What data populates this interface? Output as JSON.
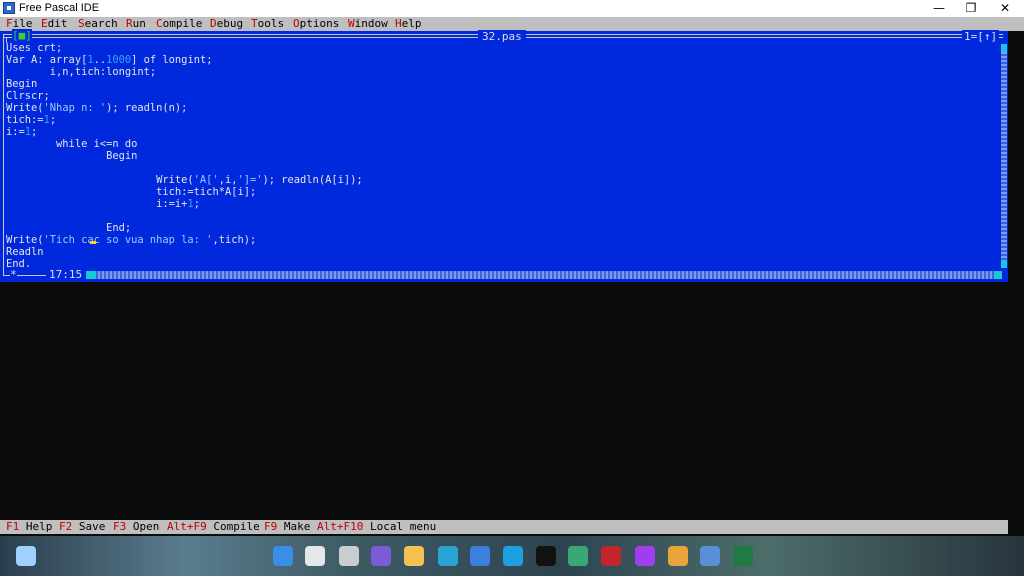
{
  "window": {
    "title": "Free Pascal IDE",
    "minimize_glyph": "—",
    "restore_glyph": "❐",
    "close_glyph": "✕"
  },
  "menu": [
    {
      "hotkey": "F",
      "rest": "ile"
    },
    {
      "hotkey": "E",
      "rest": "dit"
    },
    {
      "hotkey": "S",
      "rest": "earch"
    },
    {
      "hotkey": "R",
      "rest": "un"
    },
    {
      "hotkey": "C",
      "rest": "ompile"
    },
    {
      "hotkey": "D",
      "rest": "ebug"
    },
    {
      "hotkey": "T",
      "rest": "ools"
    },
    {
      "hotkey": "O",
      "rest": "ptions"
    },
    {
      "hotkey": "W",
      "rest": "indow"
    },
    {
      "hotkey": "H",
      "rest": "elp"
    }
  ],
  "editor": {
    "filename": "32.pas",
    "window_number": "1=[↑]",
    "close_box": "[■]",
    "modified_mark": "*",
    "cursor_position": "17:15",
    "lines": [
      [
        {
          "t": "Uses crt;"
        }
      ],
      [
        {
          "t": "Var A: array["
        },
        {
          "t": "1",
          "c": "num"
        },
        {
          "t": ".."
        },
        {
          "t": "1000",
          "c": "num"
        },
        {
          "t": "] of longint;"
        }
      ],
      [
        {
          "t": "       i,n,tich:longint;"
        }
      ],
      [
        {
          "t": "Begin"
        }
      ],
      [
        {
          "t": "Clrscr;"
        }
      ],
      [
        {
          "t": "Write("
        },
        {
          "t": "'Nhap n: '",
          "c": "str"
        },
        {
          "t": "); readln(n);"
        }
      ],
      [
        {
          "t": "tich:="
        },
        {
          "t": "1",
          "c": "num"
        },
        {
          "t": ";"
        }
      ],
      [
        {
          "t": "i:="
        },
        {
          "t": "1",
          "c": "num"
        },
        {
          "t": ";"
        }
      ],
      [
        {
          "t": "        while i<=n do"
        }
      ],
      [
        {
          "t": "                Begin"
        }
      ],
      [
        {
          "t": ""
        }
      ],
      [
        {
          "t": "                        Write("
        },
        {
          "t": "'A['",
          "c": "str"
        },
        {
          "t": ",i,"
        },
        {
          "t": "']='",
          "c": "str"
        },
        {
          "t": "); readln(A[i]);"
        }
      ],
      [
        {
          "t": "                        tich:=tich*A[i];"
        }
      ],
      [
        {
          "t": "                        i:=i+"
        },
        {
          "t": "1",
          "c": "num"
        },
        {
          "t": ";"
        }
      ],
      [
        {
          "t": ""
        }
      ],
      [
        {
          "t": "                End;"
        }
      ],
      [
        {
          "t": "Write("
        },
        {
          "t": "'Tich cac so vua nhap la: '",
          "c": "str"
        },
        {
          "t": ",tich);"
        }
      ],
      [
        {
          "t": "Readln"
        }
      ],
      [
        {
          "t": "End."
        }
      ]
    ]
  },
  "statusbar": [
    {
      "key": "F1",
      "label": " Help"
    },
    {
      "key": "F2",
      "label": " Save"
    },
    {
      "key": "F3",
      "label": " Open"
    },
    {
      "key": "Alt+F9",
      "label": " Compile"
    },
    {
      "key": "F9",
      "label": " Make"
    },
    {
      "key": "Alt+F10",
      "label": " Local menu"
    }
  ],
  "taskbar": {
    "icons": [
      {
        "name": "weather-icon",
        "color": "#9fd0ff"
      },
      {
        "name": "start-icon",
        "color": "#3a8ee6"
      },
      {
        "name": "search-icon",
        "color": "#ffffff"
      },
      {
        "name": "task-view-icon",
        "color": "#e0e0e0"
      },
      {
        "name": "chat-icon",
        "color": "#7b5bd6"
      },
      {
        "name": "file-explorer-icon",
        "color": "#f2c14e"
      },
      {
        "name": "edge-icon",
        "color": "#2aa3d6"
      },
      {
        "name": "store-icon",
        "color": "#3b7fe0"
      },
      {
        "name": "app-c-icon",
        "color": "#1d9fe0"
      },
      {
        "name": "tiktok-icon",
        "color": "#111111"
      },
      {
        "name": "app-download-icon",
        "color": "#3aa876"
      },
      {
        "name": "app-red-icon",
        "color": "#c0262b"
      },
      {
        "name": "messenger-icon",
        "color": "#a13df0"
      },
      {
        "name": "chrome-icon",
        "color": "#e8a33a"
      },
      {
        "name": "free-pascal-icon",
        "color": "#5a8fd8"
      },
      {
        "name": "excel-icon",
        "color": "#1f7a43"
      }
    ]
  }
}
